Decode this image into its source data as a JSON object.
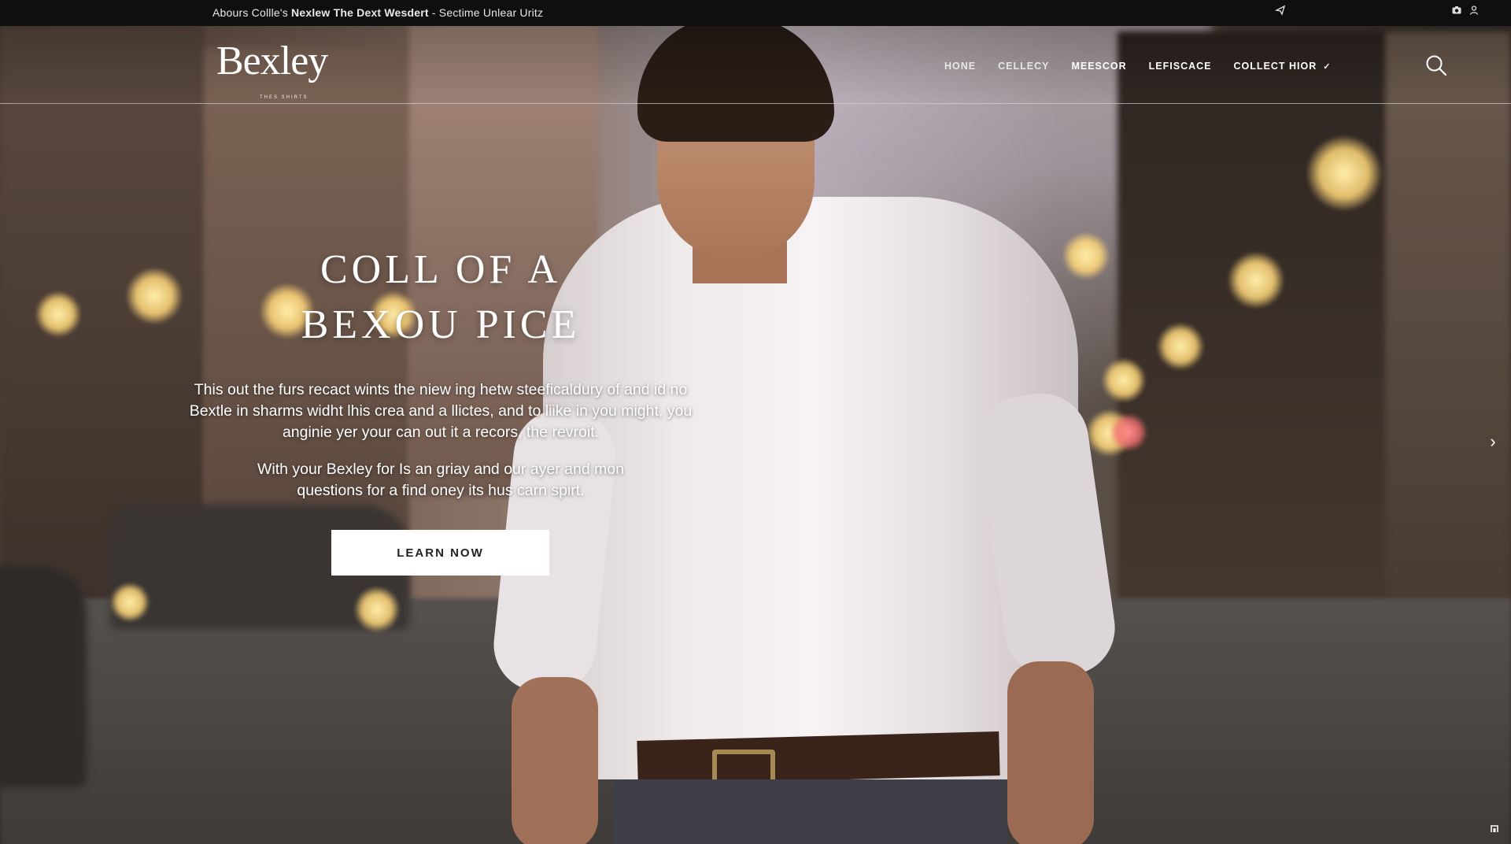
{
  "announcement": {
    "prefix": "Abours Collle's ",
    "bold": "Nexlew The Dext Wesdert",
    "suffix": " - Sectime Unlear Uritz"
  },
  "header": {
    "logo": "Bexley",
    "logo_sub": "THES SHIRTS",
    "nav": [
      {
        "label": "HONE"
      },
      {
        "label": "CELLECY"
      },
      {
        "label": "MEESCOR"
      },
      {
        "label": "LEFISCACE"
      },
      {
        "label": "COLLECT HIOR",
        "has_dropdown": true
      }
    ],
    "icons": {
      "search": "search-icon",
      "share": "share-icon",
      "camera": "camera-icon",
      "user": "user-icon"
    }
  },
  "hero": {
    "title_line1": "COLL OF A",
    "title_line2": "BEXOU PICE",
    "paragraph1": "This out the furs recact wints the niew ing hetw steeficaldury of and id no Bextle in sharms widht lhis crea and a llictes, and to liike in you might, you anginie yer your can out it a recors, the revroit.",
    "paragraph2": "With your Bexley for Is an griay and our ayer and mon questions for a find oney its hus carn spirt.",
    "cta_label": "LEARN NOW"
  },
  "carousel": {
    "next_icon": "chevron-right-icon"
  }
}
